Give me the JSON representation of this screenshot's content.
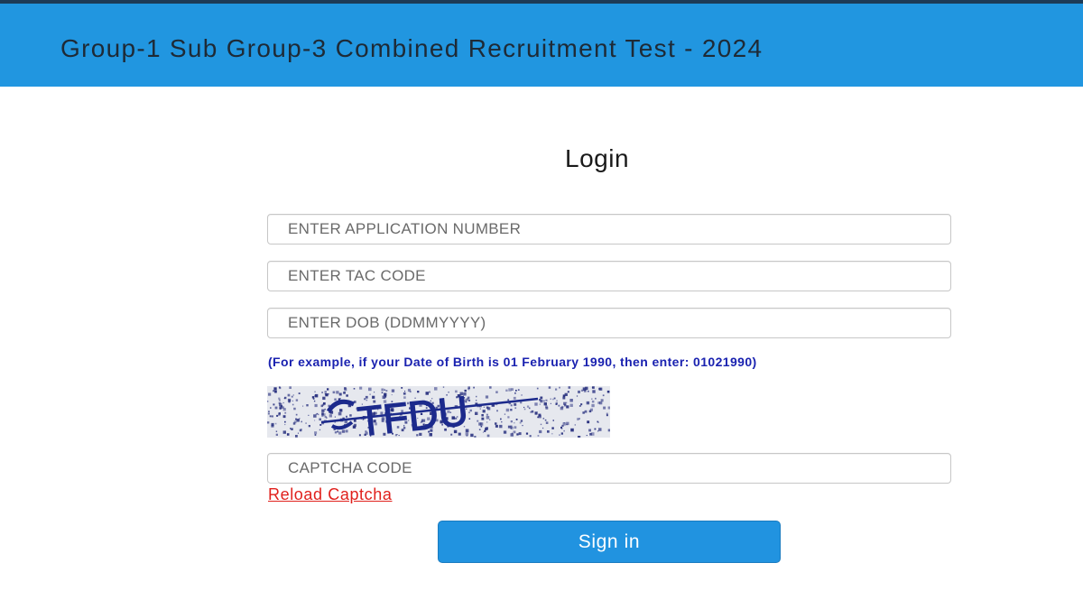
{
  "header": {
    "title": "Group-1 Sub Group-3 Combined Recruitment Test - 2024"
  },
  "login": {
    "heading": "Login",
    "application_number": {
      "value": "",
      "placeholder": "ENTER APPLICATION NUMBER"
    },
    "tac_code": {
      "value": "",
      "placeholder": "ENTER TAC CODE"
    },
    "dob": {
      "value": "",
      "placeholder": "ENTER DOB (DDMMYYYY)"
    },
    "dob_hint": "(For example, if your Date of Birth is 01 February 1990, then enter: 01021990)",
    "captcha_image": {
      "text": "TFDU"
    },
    "captcha_input": {
      "value": "",
      "placeholder": "CAPTCHA CODE"
    },
    "reload_captcha_label": "Reload Captcha",
    "sign_in_label": "Sign in"
  },
  "colors": {
    "header_bg": "#2196e0",
    "button_bg": "#2193e0",
    "hint_text": "#1a22b0",
    "reload_link": "#e0201c",
    "captcha_text": "#1c2a8c"
  }
}
